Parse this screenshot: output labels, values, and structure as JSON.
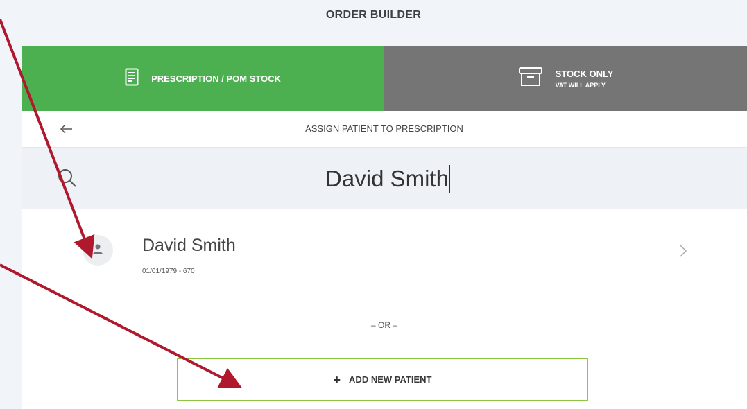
{
  "page": {
    "title": "ORDER BUILDER"
  },
  "tabs": {
    "prescription": {
      "label": "PRESCRIPTION / POM STOCK",
      "icon": "document-icon",
      "color": "#4caf50"
    },
    "stock": {
      "label": "STOCK ONLY",
      "sublabel": "VAT WILL APPLY",
      "icon": "archive-box-icon",
      "color": "#757575"
    }
  },
  "subheader": {
    "title": "ASSIGN PATIENT TO PRESCRIPTION",
    "back_icon": "back-arrow-icon"
  },
  "search": {
    "value": "David Smith",
    "icon": "search-icon"
  },
  "results": [
    {
      "name": "David Smith",
      "meta": "01/01/1979 - 670",
      "icon": "user-icon"
    }
  ],
  "divider": {
    "text": "– OR –"
  },
  "add_button": {
    "plus": "+",
    "label": "ADD NEW PATIENT",
    "border_color": "#8cc63f"
  },
  "annotation": {
    "arrow_color": "#b0182e"
  }
}
